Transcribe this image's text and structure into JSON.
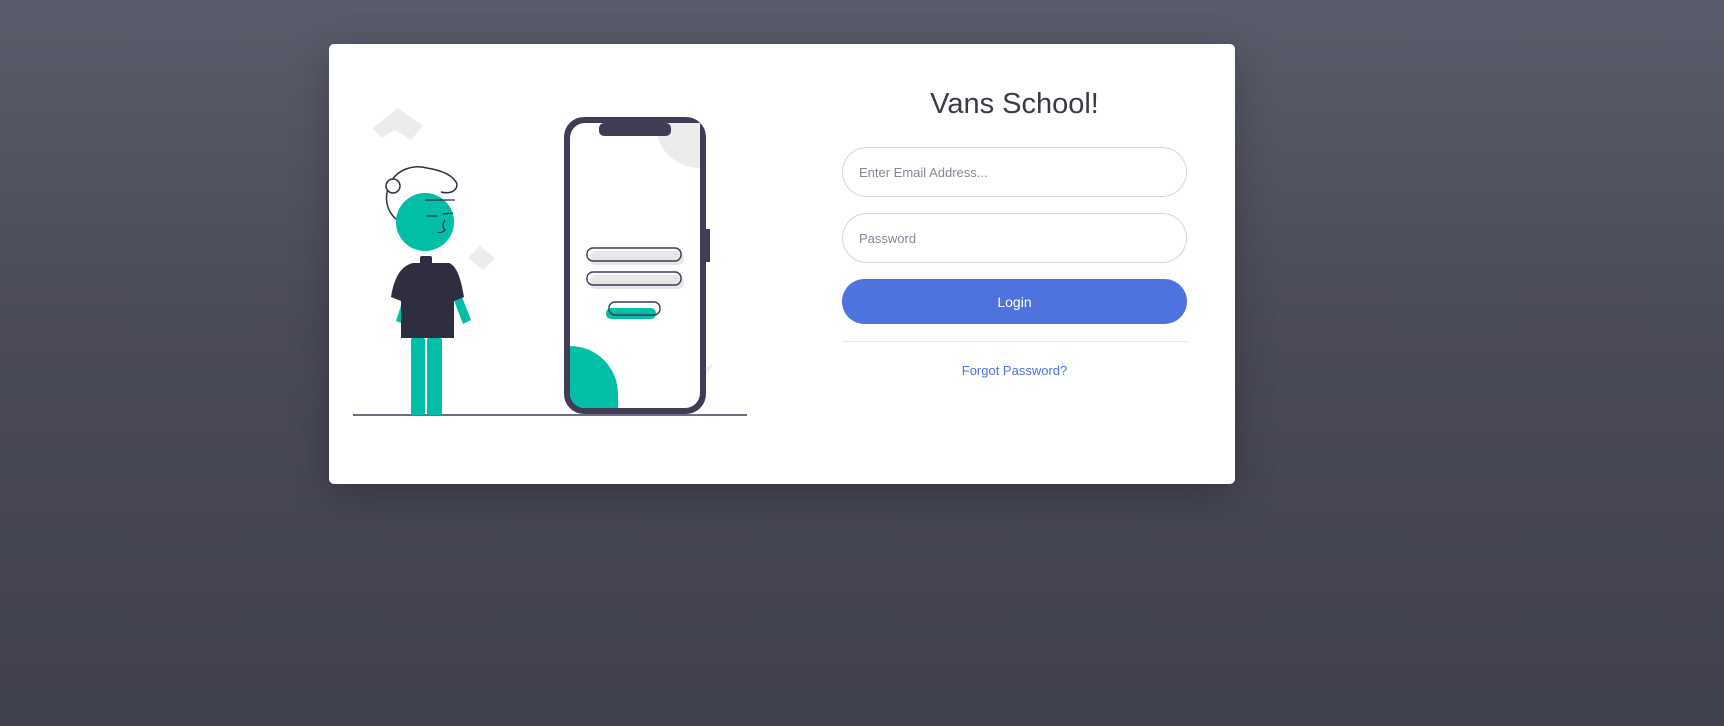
{
  "login": {
    "title": "Vans School!",
    "email_placeholder": "Enter Email Address...",
    "password_placeholder": "Password",
    "login_label": "Login",
    "forgot_label": "Forgot Password?"
  },
  "colors": {
    "background": "#4a4b57",
    "card": "#ffffff",
    "primary": "#4e73df",
    "accent_teal": "#00bfa6",
    "dark_ink": "#3f3d56"
  },
  "icons": {
    "illustration": "person-with-phone-login-illustration"
  }
}
